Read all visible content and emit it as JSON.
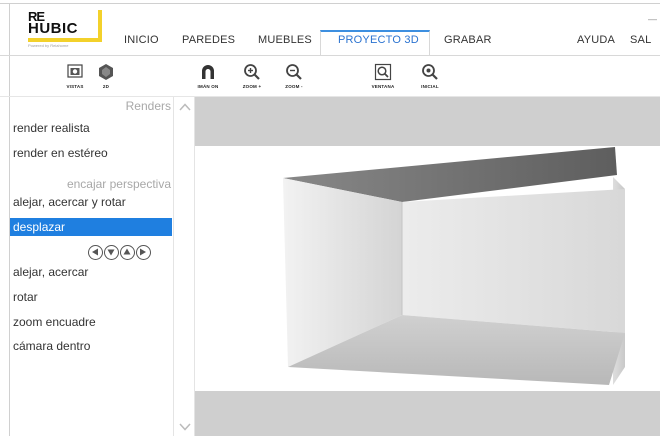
{
  "logo": {
    "line1": "RE",
    "line2": "HUBIC",
    "tagline": "Powered by Reiahome"
  },
  "menu": {
    "items": [
      "INICIO",
      "PAREDES",
      "MUEBLES",
      "PROYECTO 3D",
      "GRABAR",
      "AYUDA",
      "SAL"
    ],
    "active": "PROYECTO 3D",
    "minimize": "—"
  },
  "toolbar": {
    "tools": [
      "VISTAS",
      "2D",
      "IMÁN ON",
      "ZOOM +",
      "ZOOM -",
      "VENTANA",
      "INICIAL"
    ]
  },
  "panel": {
    "header": "Renders",
    "items": [
      "render realista",
      "render en estéreo"
    ],
    "subheader": "encajar perspectiva",
    "perspective_items": [
      "alejar, acercar y rotar",
      "desplazar",
      "alejar, acercar",
      "rotar",
      "zoom encuadre",
      "cámara dentro"
    ],
    "selected": "desplazar"
  },
  "colors": {
    "accent": "#1f7fe0",
    "tab_active": "#2b73d0",
    "logo_yellow": "#f3d12b",
    "viewport_band": "#cfcfcf"
  }
}
